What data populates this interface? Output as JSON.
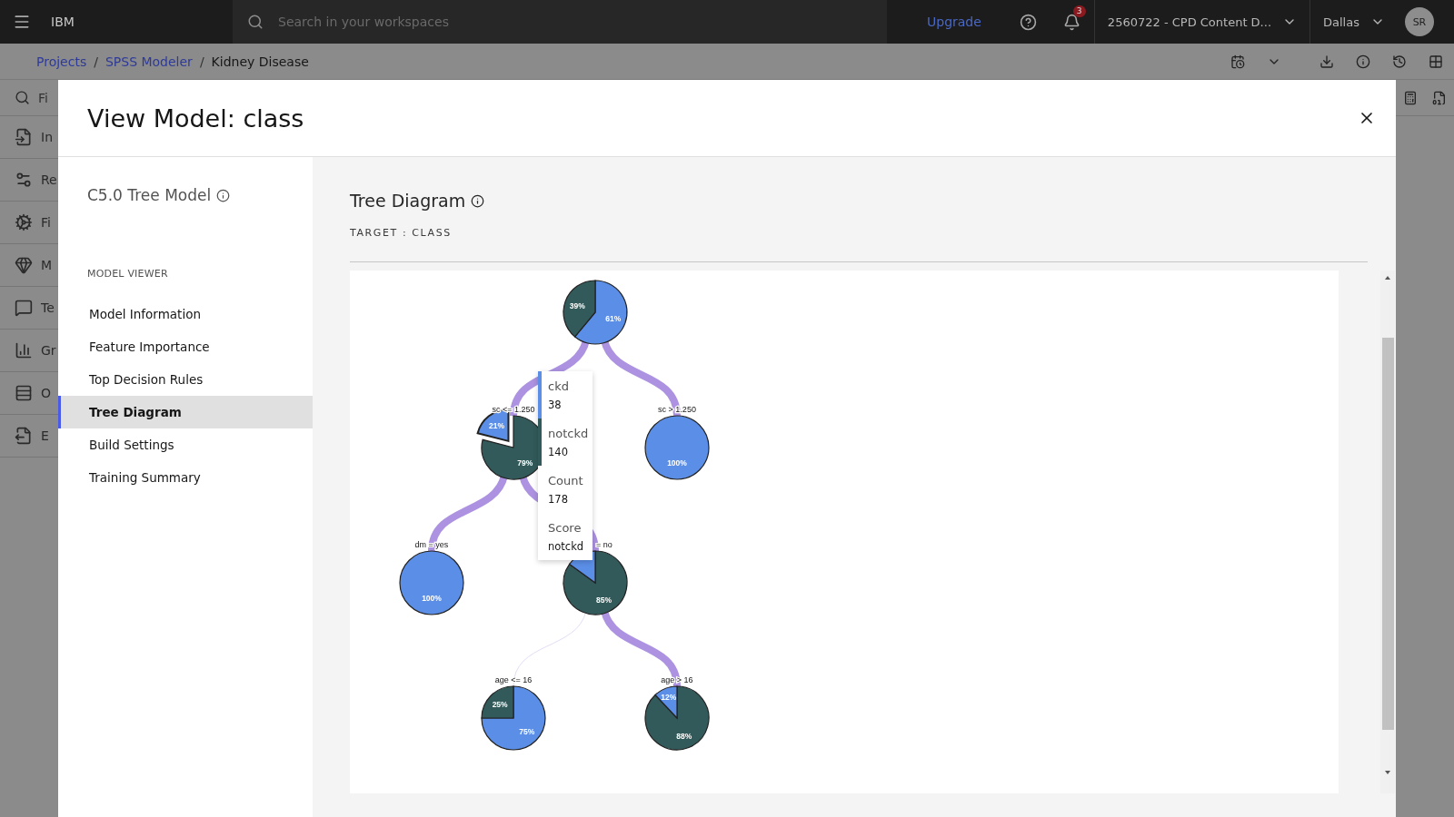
{
  "header": {
    "brand": "IBM",
    "search": {
      "placeholder": "Search in your workspaces"
    },
    "upgrade": "Upgrade",
    "notifications": "3",
    "account": "2560722 - CPD Content D...",
    "region": "Dallas",
    "avatar": "SR"
  },
  "breadcrumbs": [
    {
      "label": "Projects",
      "link": true
    },
    {
      "separator": "/",
      "label": "SPSS Modeler",
      "link": true
    },
    {
      "separator": "/",
      "label": "Kidney Disease",
      "link": false
    }
  ],
  "background_sidebar": {
    "search": {
      "placeholder": "Fi"
    },
    "items": [
      "In",
      "Re",
      "Fi",
      "M",
      "Te",
      "Gr",
      "O",
      "E"
    ]
  },
  "modal": {
    "title": "View Model: class",
    "nav": {
      "model_title": "C5.0 Tree Model",
      "section": "MODEL VIEWER",
      "items": [
        {
          "label": "Model Information",
          "selected": false
        },
        {
          "label": "Feature Importance",
          "selected": false
        },
        {
          "label": "Top Decision Rules",
          "selected": false
        },
        {
          "label": "Tree Diagram",
          "selected": true
        },
        {
          "label": "Build Settings",
          "selected": false
        },
        {
          "label": "Training Summary",
          "selected": false
        }
      ]
    },
    "content": {
      "title": "Tree Diagram",
      "target": "TARGET : CLASS",
      "tree": {
        "root": {
          "ckd_text": "61%",
          "notckd_text": "39%",
          "selected": false,
          "children": [
            {
              "label": "sc <= 1.250",
              "label_clipped": false,
              "faint": false,
              "ckd_text": "21%",
              "notckd_text": "79%",
              "selected": true,
              "children": [
                {
                  "label": "dm = yes",
                  "label_clipped": false,
                  "faint": false,
                  "ckd_text": "100%",
                  "selected": false
                },
                {
                  "label": "= no",
                  "label_clipped": true,
                  "faint": false,
                  "notckd_text": "85%",
                  "selected": false,
                  "children": [
                    {
                      "label": "age <= 16",
                      "label_clipped": false,
                      "faint": true,
                      "ckd_text": "75%",
                      "notckd_text": "25%",
                      "selected": false
                    },
                    {
                      "label": "age > 16",
                      "label_clipped": false,
                      "faint": false,
                      "ckd_text": "12%",
                      "notckd_text": "88%",
                      "selected": false
                    }
                  ]
                }
              ]
            },
            {
              "label": "sc > 1.250",
              "label_clipped": false,
              "faint": false,
              "ckd_text": "100%",
              "selected": false
            }
          ]
        },
        "tooltip": [
          {
            "label": "ckd",
            "value": "38",
            "color": "#5b8ee6"
          },
          {
            "label": "notckd",
            "value": "140",
            "color": "#325a5a"
          },
          {
            "label": "Count",
            "value": "178"
          },
          {
            "label": "Score",
            "value": "notckd"
          }
        ]
      }
    }
  }
}
